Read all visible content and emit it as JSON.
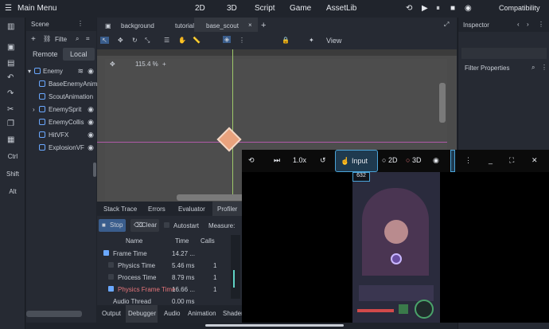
{
  "topbar": {
    "main_menu": "Main Menu",
    "tabs": [
      "2D",
      "3D",
      "Script",
      "Game",
      "AssetLib"
    ],
    "compat": "Compatibility"
  },
  "left_tools": {
    "ctrl": "Ctrl",
    "shift": "Shift",
    "alt": "Alt"
  },
  "scene": {
    "title": "Scene",
    "filter": "Filte",
    "remote": "Remote",
    "local": "Local",
    "nodes": [
      "Enemy",
      "BaseEnemyAnima",
      "ScoutAnimation",
      "EnemySprit",
      "EnemyCollis",
      "HitVFX",
      "ExplosionVF"
    ]
  },
  "editor": {
    "tabs": [
      "background",
      "tutorial",
      "base_scout"
    ],
    "view": "View",
    "zoom": "115.4 %"
  },
  "inspector": {
    "title": "Inspector",
    "filter": "Filter Properties"
  },
  "debugger": {
    "tabs": [
      "Stack Trace",
      "Errors",
      "Evaluator",
      "Profiler"
    ],
    "stop": "Stop",
    "clear": "Clear",
    "autostart": "Autostart",
    "measure": "Measure:",
    "cols": [
      "Name",
      "Time",
      "Calls"
    ],
    "rows": [
      {
        "name": "Frame Time",
        "time": "14.27 ...",
        "calls": ""
      },
      {
        "name": "Physics Time",
        "time": "5.46 ms",
        "calls": "1"
      },
      {
        "name": "Process Time",
        "time": "8.79 ms",
        "calls": "1"
      },
      {
        "name": "Physics Frame Time",
        "time": "16.66 ...",
        "calls": "1"
      },
      {
        "name": "Audio Thread",
        "time": "0.00 ms",
        "calls": ""
      }
    ]
  },
  "bottom_tabs": [
    "Output",
    "Debugger",
    "Audio",
    "Animation",
    "Shader"
  ],
  "game": {
    "speed": "1.0x",
    "input": "Input",
    "mode2d": "2D",
    "mode3d": "3D",
    "score": "632"
  }
}
